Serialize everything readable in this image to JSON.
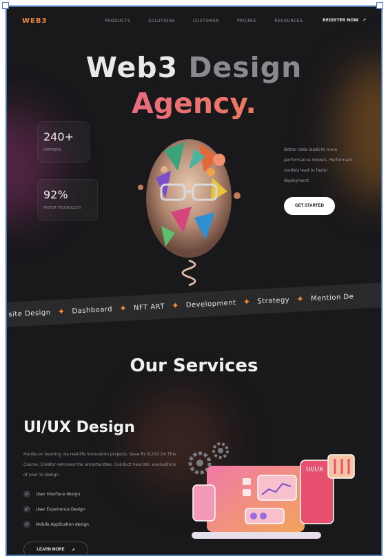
{
  "nav": {
    "logo": "WEB3",
    "menu": [
      "PRODUCTS",
      "SOLUTIONS",
      "CUSTOMER",
      "PRICING",
      "RESOURCES"
    ],
    "register": "REGISTER NOW",
    "register_icon": "arrow-up-right-icon"
  },
  "hero": {
    "title_part1": "Web3",
    "title_part2": "Design",
    "subtitle": "Agency.",
    "stats": [
      {
        "value": "240+",
        "label": "PARTNERS"
      },
      {
        "value": "92%",
        "label": "FASTER TECHNOLOGY"
      }
    ],
    "side_text": "Better data leads to more performance models. Performant models lead to faster deployment.",
    "cta": "GET STARTED"
  },
  "ticker": [
    "site Design",
    "Dashboard",
    "NFT ART",
    "Development",
    "Strategy",
    "Mention De"
  ],
  "services": {
    "title": "Our Services",
    "uiux_title": "UI/UX Design",
    "paragraph": "Hands-on learning via real-life innovation projects. Save Rs 8,210 On This Course. Creator removes the uncertainties. Conduct heuristic evaluations of your UI design.",
    "list": [
      "User interface design",
      "User Experience Design",
      "Mobile Application design"
    ],
    "learn_more": "LEARN MORE",
    "illustration_label": "UI/UX"
  },
  "colors": {
    "background": "#19181b",
    "accent_orange": "#f08a3a",
    "accent_pink": "#e85aa3",
    "frame_border": "#4a78b5"
  }
}
